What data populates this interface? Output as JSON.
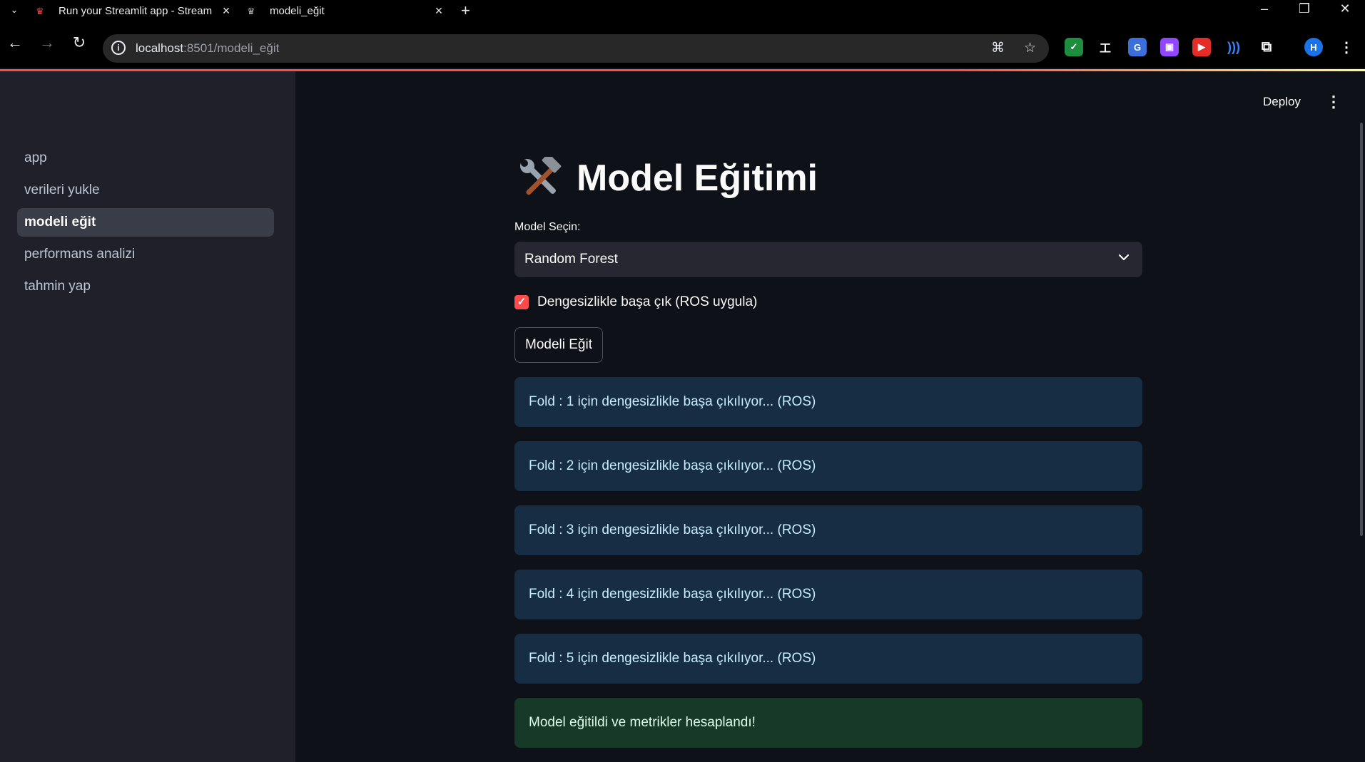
{
  "browser": {
    "tabs": [
      {
        "title": "Run your Streamlit app - Stream",
        "favicon": "streamlit-crown-icon",
        "active": false
      },
      {
        "title": "modeli_eğit",
        "favicon": "streamlit-crown-icon",
        "active": true
      }
    ],
    "url_host": "localhost",
    "url_rest": ":8501/modeli_eğit",
    "profile_initial": "H"
  },
  "app": {
    "deploy_label": "Deploy",
    "accent_color": "#ff4b4b"
  },
  "sidebar": {
    "items": [
      {
        "label": "app",
        "active": false
      },
      {
        "label": "verileri yukle",
        "active": false
      },
      {
        "label": "modeli eğit",
        "active": true
      },
      {
        "label": "performans analizi",
        "active": false
      },
      {
        "label": "tahmin yap",
        "active": false
      }
    ]
  },
  "main": {
    "title": "Model Eğitimi",
    "title_icon": "hammer-and-wrench-icon",
    "select_label": "Model Seçin:",
    "select_value": "Random Forest",
    "checkbox_label": "Dengesizlikle başa çık (ROS uygula)",
    "checkbox_checked": true,
    "button_label": "Modeli Eğit",
    "info_messages": [
      "Fold : 1 için dengesizlikle başa çıkılıyor... (ROS)",
      "Fold : 2 için dengesizlikle başa çıkılıyor... (ROS)",
      "Fold : 3 için dengesizlikle başa çıkılıyor... (ROS)",
      "Fold : 4 için dengesizlikle başa çıkılıyor... (ROS)",
      "Fold : 5 için dengesizlikle başa çıkılıyor... (ROS)"
    ],
    "success_message": "Model eğitildi ve metrikler hesaplandı!"
  }
}
